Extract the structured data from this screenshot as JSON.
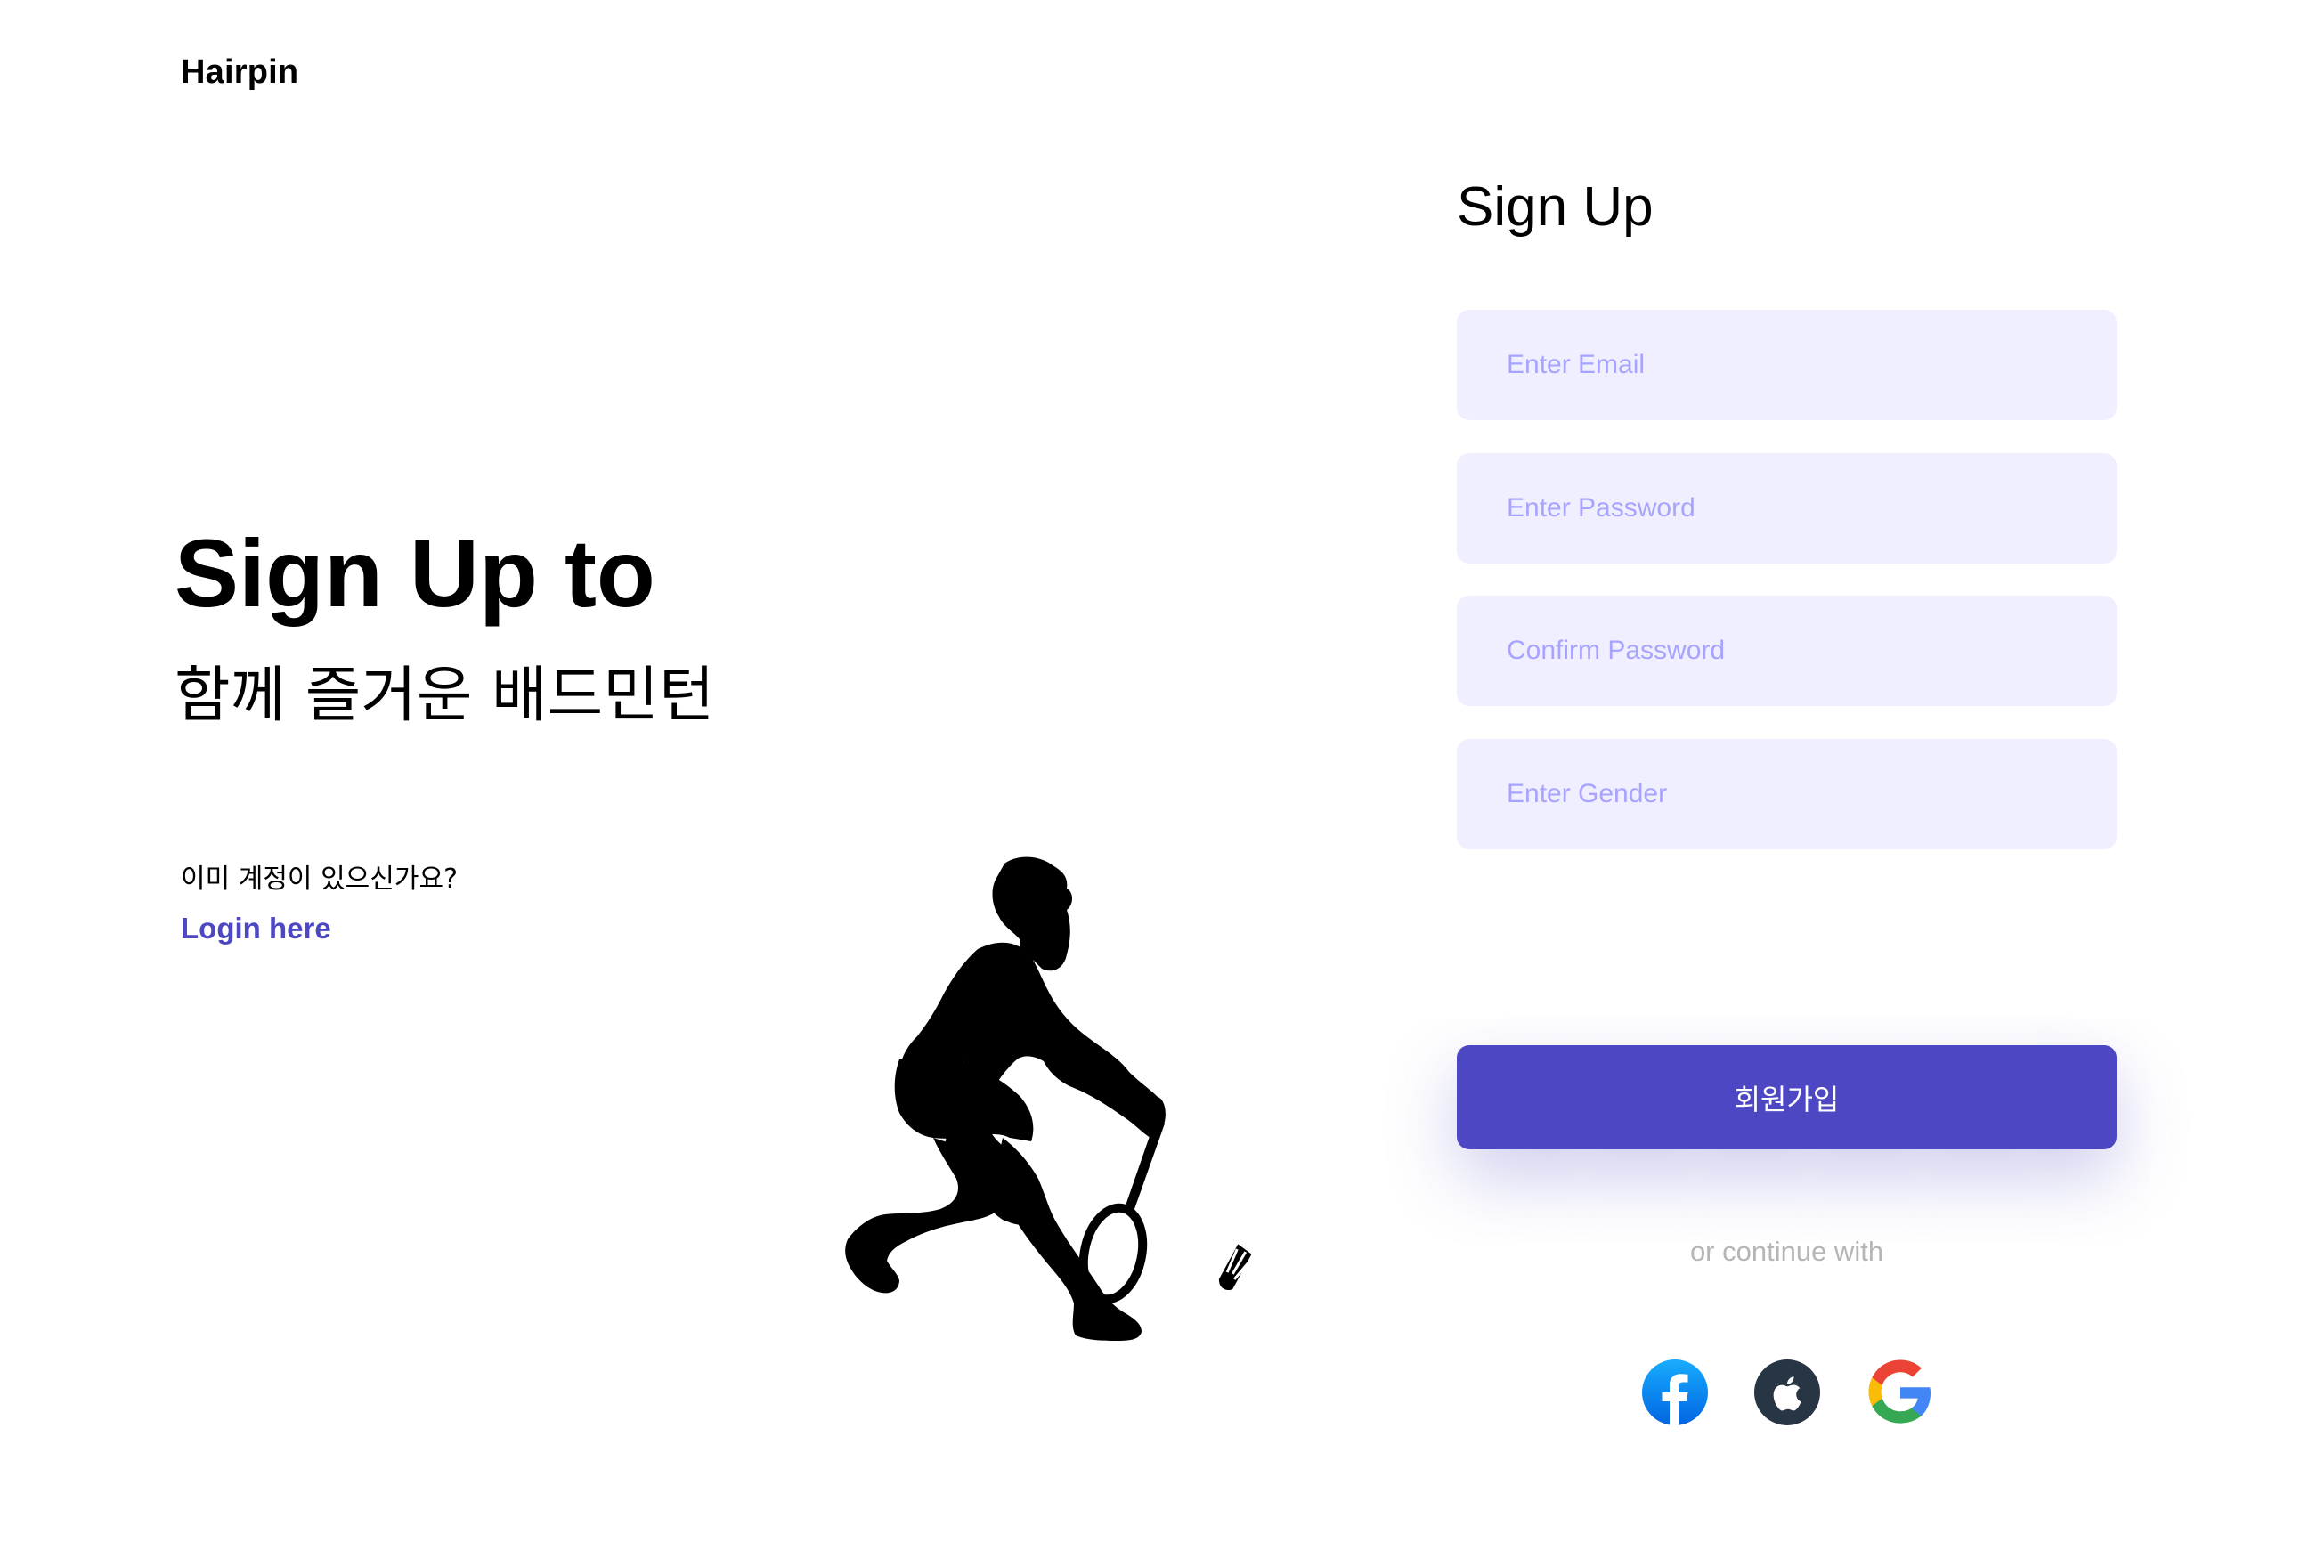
{
  "brand": {
    "name": "Hairpin"
  },
  "hero": {
    "title": "Sign Up to",
    "subtitle": "함께 즐거운 배드민턴",
    "has_account_text": "이미 계정이 있으신가요?",
    "login_link": "Login here"
  },
  "form": {
    "title": "Sign Up",
    "fields": [
      {
        "placeholder": "Enter Email"
      },
      {
        "placeholder": "Enter Password"
      },
      {
        "placeholder": "Confirm Password"
      },
      {
        "placeholder": "Enter Gender"
      }
    ],
    "submit_label": "회원가입",
    "continue_text": "or continue with",
    "socials": [
      "facebook-icon",
      "apple-icon",
      "google-icon"
    ]
  },
  "colors": {
    "accent": "#4d47c3",
    "field_bg": "#f0efff",
    "placeholder": "#a7a3ff",
    "muted": "#b5b5b5"
  }
}
